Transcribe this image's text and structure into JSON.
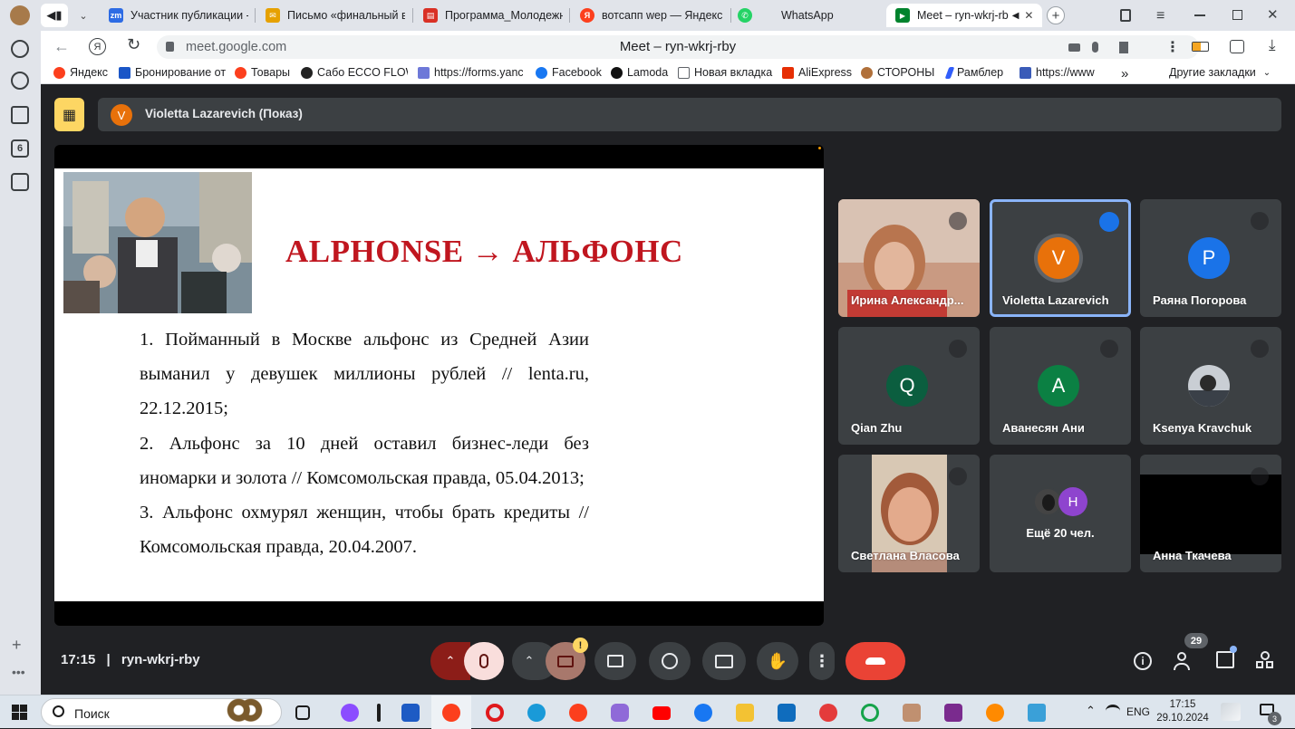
{
  "browser": {
    "tabs": [
      {
        "title": "Участник публикации -",
        "color": "#2d6be4",
        "glyph": "zm"
      },
      {
        "title": "Письмо «финальный ва",
        "color": "#e6a100",
        "glyph": "✉"
      },
      {
        "title": "Программа_Молодежн",
        "color": "#d93025",
        "glyph": "▤"
      },
      {
        "title": "вотсапп wep — Яндекс",
        "color": "#fc3f1d",
        "glyph": "Я"
      },
      {
        "title": "WhatsApp",
        "color": "#25d366",
        "glyph": "✆"
      },
      {
        "title": "Meet – ryn-wkrj-rb",
        "color": "#00832d",
        "glyph": "▶",
        "active": true
      }
    ],
    "url": "meet.google.com",
    "page_title": "Meet – ryn-wkrj-rby",
    "bookmarks": [
      {
        "label": "Яндекс",
        "color": "#fc3f1d"
      },
      {
        "label": "Бронирование от",
        "color": "#1a56c7"
      },
      {
        "label": "Товары",
        "color": "#fc3f1d"
      },
      {
        "label": "Сабо ECCO FLOW",
        "color": "#222222"
      },
      {
        "label": "https://forms.yanc",
        "color": "#6d78d8"
      },
      {
        "label": "Facebook",
        "color": "#1877f2"
      },
      {
        "label": "Lamoda",
        "color": "#111111"
      },
      {
        "label": "Новая вкладка",
        "color": "#5f6368"
      },
      {
        "label": "AliExpress",
        "color": "#e62e04"
      },
      {
        "label": "СТОРОНЫ",
        "color": "#b0703a"
      },
      {
        "label": "Рамблер",
        "color": "#315efb"
      },
      {
        "label": "https://www",
        "color": "#3a5bb8"
      }
    ],
    "bookmarks_more": "»",
    "other_bookmarks": "Другие закладки"
  },
  "meet": {
    "presenter_label": "Violetta Lazarevich (Показ)",
    "presenter_initial": "V",
    "slide": {
      "title": "ALPHONSE → АЛЬФОНС",
      "items": [
        "1. Пойманный в Москве альфонс из Средней Азии выманил у девушек миллионы рублей // lenta.ru, 22.12.2015;",
        "2. Альфонс за 10 дней оставил бизнес-леди без иномарки и золота // Комсомольская правда, 05.04.2013;",
        "3. Альфонс охмурял женщин, чтобы брать кредиты // Комсомольская правда, 20.04.2007."
      ]
    },
    "participants": [
      {
        "name": "Ирина Александр...",
        "type": "video",
        "muted": true
      },
      {
        "name": "Violetta Lazarevich",
        "initial": "V",
        "color": "#e8710a",
        "speaking": true
      },
      {
        "name": "Раяна Погорова",
        "initial": "P",
        "color": "#1a73e8",
        "muted": true
      },
      {
        "name": "Qian Zhu",
        "initial": "Q",
        "color": "#0b5e3f",
        "muted": true
      },
      {
        "name": "Аванесян Ани",
        "initial": "A",
        "color": "#0b8043",
        "muted": true
      },
      {
        "name": "Ksenya Kravchuk",
        "type": "photo",
        "muted": true
      },
      {
        "name": "Светлана Власова",
        "type": "video2",
        "muted": true
      },
      {
        "name": "Ещё 20 чел.",
        "type": "more",
        "initial": "H"
      },
      {
        "name": "Анна Ткачева",
        "type": "black",
        "muted": true
      }
    ],
    "time": "17:15",
    "separator": "|",
    "meeting_code": "ryn-wkrj-rby",
    "participant_count": "29",
    "camera_warning": "!"
  },
  "taskbar": {
    "search_label": "Поиск",
    "lang": "ENG",
    "time": "17:15",
    "date": "29.10.2024",
    "notif_count": "3"
  }
}
